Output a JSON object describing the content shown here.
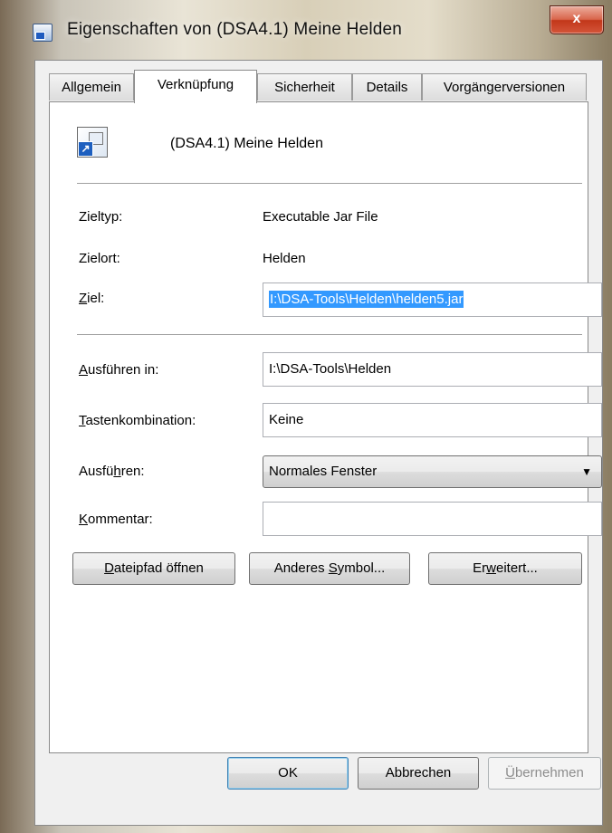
{
  "window": {
    "title": "Eigenschaften von (DSA4.1) Meine Helden",
    "close_label": "x"
  },
  "tabs": [
    {
      "label": "Allgemein",
      "active": false
    },
    {
      "label": "Verknüpfung",
      "active": true
    },
    {
      "label": "Sicherheit",
      "active": false
    },
    {
      "label": "Details",
      "active": false
    },
    {
      "label": "Vorgängerversionen",
      "active": false
    }
  ],
  "shortcut": {
    "name": "(DSA4.1) Meine Helden",
    "icon": "shortcut-file-icon"
  },
  "fields": {
    "zieltyp_label": "Zieltyp:",
    "zieltyp_value": "Executable Jar File",
    "zielort_label": "Zielort:",
    "zielort_value": "Helden",
    "ziel_label_u": "Z",
    "ziel_label_rest": "iel:",
    "ziel_value": "I:\\DSA-Tools\\Helden\\helden5.jar",
    "ausfuehren_in_label_u": "A",
    "ausfuehren_in_label_rest": "usführen in:",
    "ausfuehren_in_value": "I:\\DSA-Tools\\Helden",
    "tasten_label_u": "T",
    "tasten_label_rest": "astenkombination:",
    "tasten_value": "Keine",
    "ausfuehren_label_pre": "Ausfü",
    "ausfuehren_label_u": "h",
    "ausfuehren_label_rest": "ren:",
    "ausfuehren_value": "Normales Fenster",
    "kommentar_label_u": "K",
    "kommentar_label_rest": "ommentar:",
    "kommentar_value": ""
  },
  "buttons": {
    "dateipfad_u": "D",
    "dateipfad_rest": "ateipfad öffnen",
    "symbol_pre": "Anderes ",
    "symbol_u": "S",
    "symbol_rest": "ymbol...",
    "erweitert_pre": "Er",
    "erweitert_u": "w",
    "erweitert_rest": "eitert...",
    "ok": "OK",
    "abbrechen": "Abbrechen",
    "uebernehmen_u": "Ü",
    "uebernehmen_rest": "bernehmen"
  }
}
